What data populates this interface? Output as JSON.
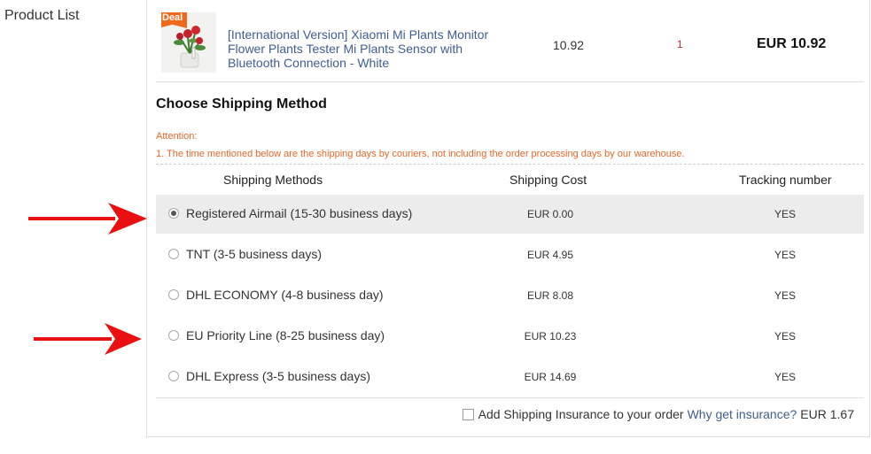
{
  "side_label": "Product List",
  "product": {
    "badge": "Deal",
    "name": "[International Version] Xiaomi Mi Plants Monitor Flower Plants Tester Mi Plants Sensor with Bluetooth Connection - White",
    "price": "10.92",
    "quantity": "1",
    "total": "EUR 10.92"
  },
  "shipping": {
    "title": "Choose Shipping Method",
    "attention_label": "Attention:",
    "notice": "1. The time mentioned below are the shipping days by couriers, not including the order processing days by our warehouse.",
    "headers": {
      "method": "Shipping Methods",
      "cost": "Shipping Cost",
      "tracking": "Tracking number"
    },
    "methods": [
      {
        "name": "Registered Airmail (15-30 business days)",
        "cost": "EUR 0.00",
        "tracking": "YES",
        "selected": true
      },
      {
        "name": "TNT (3-5 business days)",
        "cost": "EUR 4.95",
        "tracking": "YES",
        "selected": false
      },
      {
        "name": "DHL ECONOMY (4-8 business day)",
        "cost": "EUR 8.08",
        "tracking": "YES",
        "selected": false
      },
      {
        "name": "EU Priority Line (8-25 business day)",
        "cost": "EUR 10.23",
        "tracking": "YES",
        "selected": false
      },
      {
        "name": "DHL Express (3-5 business days)",
        "cost": "EUR 14.69",
        "tracking": "YES",
        "selected": false
      }
    ]
  },
  "insurance": {
    "label": "Add Shipping Insurance to your order",
    "link": "Why get insurance?",
    "price": "EUR 1.67",
    "checked": false
  },
  "colors": {
    "accent_orange": "#e8672a",
    "link_blue": "#3e5d8f",
    "arrow_red": "#e81010",
    "selected_row_bg": "#ececec"
  }
}
